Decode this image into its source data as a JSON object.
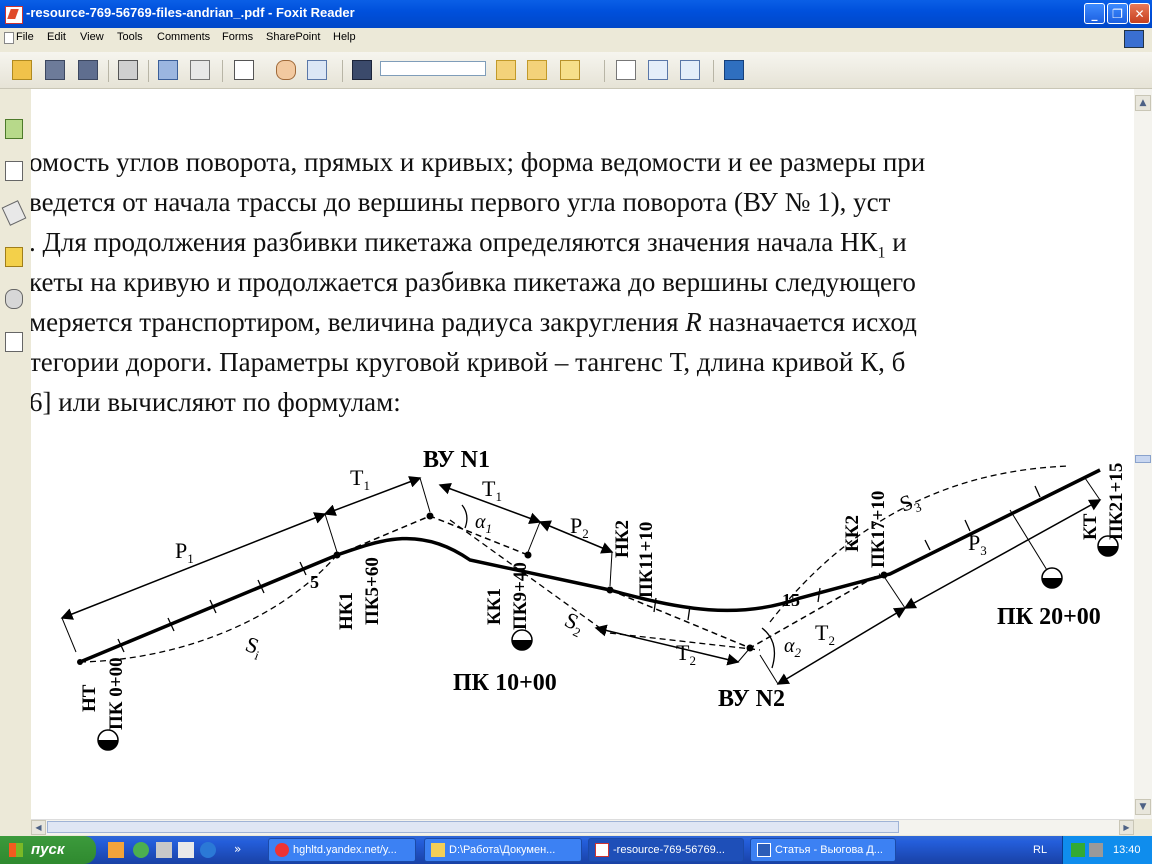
{
  "window": {
    "title": "-resource-769-56769-files-andrian_.pdf - Foxit Reader",
    "minimize": "_",
    "maximize": "❐",
    "close": "✕"
  },
  "menu": [
    "File",
    "Edit",
    "View",
    "Tools",
    "Comments",
    "Forms",
    "SharePoint",
    "Help"
  ],
  "toolbar": {
    "find_value": "",
    "icons": [
      "open-icon",
      "save-icon",
      "save-as-icon",
      "print-icon",
      "screen-icon",
      "snapshot-icon",
      "page-icon",
      "hand-icon",
      "select-text-icon",
      "find-icon",
      "prev-icon",
      "next-icon",
      "highlight-icon",
      "zoom-icon",
      "rotate-icon",
      "fit-icon",
      "typewriter-icon"
    ]
  },
  "document": {
    "lines": [
      "омость углов поворота, прямых и кривых; форма ведомости и ее размеры при",
      "ведется от начала трассы до вершины первого угла поворота (ВУ № 1), уст",
      ". Для продолжения разбивки пикетажа определяются значения начала НК",
      "кеты на кривую и продолжается разбивка пикетажа до вершины следующего",
      "меряется транспортиром, величина радиуса закругления",
      "тегории дороги. Параметры круговой кривой – тангенс Т, длина кривой К, б",
      "6] или вычисляют по формулам:"
    ],
    "line3_sub": "1",
    "line3_tail": " и",
    "line5_var": "R",
    "line5_tail": " назначается исход",
    "figure": {
      "vu1": "ВУ N1",
      "vu2": "ВУ N2",
      "T1": "T",
      "T2": "T",
      "sub1": "1",
      "sub2": "2",
      "sub3": "3",
      "P": "P",
      "S": "S",
      "Si": "S",
      "si_sub": "i",
      "alpha": "α",
      "pk10": "ПК 10+00",
      "pk20": "ПК 20+00",
      "nt": "НТ",
      "pk0": "ПК 0+00",
      "nk1": "НК1",
      "pk5": "ПК5+60",
      "kk1": "КК1",
      "pk9": "ПК9+40",
      "nk2": "НК2",
      "pk11": "ПК11+10",
      "kk2": "КК2",
      "pk17": "ПК17+10",
      "kt": "КТ",
      "pk21": "ПК21+15",
      "n5": "5",
      "n15": "15"
    }
  },
  "taskbar": {
    "start": "пуск",
    "tasks": [
      {
        "label": "hghltd.yandex.net/y..."
      },
      {
        "label": "D:\\Работа\\Докумен..."
      },
      {
        "label": "-resource-769-56769..."
      },
      {
        "label": "Статья - Вьюгова Д..."
      }
    ],
    "lang": "RL",
    "time": "13:40"
  }
}
